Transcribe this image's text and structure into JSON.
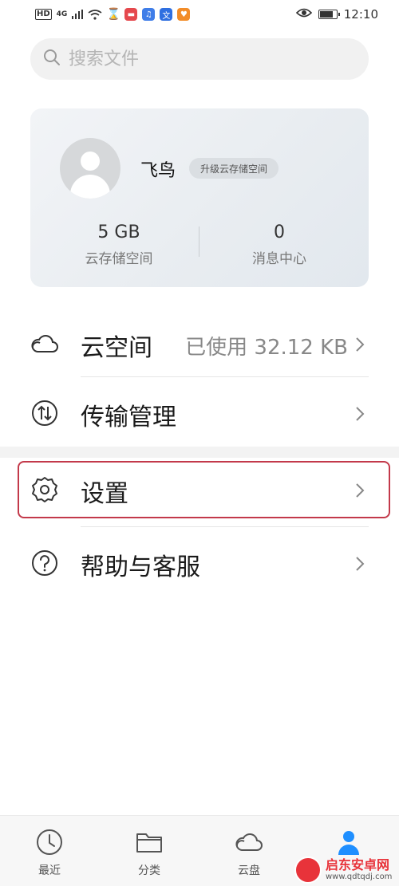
{
  "status_bar": {
    "hd": "HD",
    "network": "4G",
    "app_icons": [
      {
        "name": "hourglass",
        "glyph": "⌛",
        "color": "#333333"
      },
      {
        "name": "red-app",
        "glyph": "▬",
        "color": "#e5484d"
      },
      {
        "name": "music-app",
        "glyph": "♫",
        "color": "#3f7de8"
      },
      {
        "name": "translate-app",
        "glyph": "文",
        "color": "#2f6fe0"
      },
      {
        "name": "orange-app",
        "glyph": "♥",
        "color": "#f28c28"
      }
    ],
    "time": "12:10",
    "battery_level": 0.85
  },
  "search": {
    "placeholder": "搜索文件"
  },
  "profile": {
    "username": "飞鸟",
    "upgrade_label": "升级云存储空间",
    "stats": [
      {
        "value": "5 GB",
        "label": "云存储空间"
      },
      {
        "value": "0",
        "label": "消息中心"
      }
    ]
  },
  "menu": {
    "cloud_space": {
      "label": "云空间",
      "trail": "已使用 32.12 KB"
    },
    "transfer": {
      "label": "传输管理"
    },
    "settings": {
      "label": "设置"
    },
    "help": {
      "label": "帮助与客服"
    }
  },
  "tabs": [
    {
      "label": "最近",
      "icon": "clock-icon"
    },
    {
      "label": "分类",
      "icon": "folder-icon"
    },
    {
      "label": "云盘",
      "icon": "cloud-icon"
    },
    {
      "label": "",
      "icon": "user-icon",
      "active": true
    }
  ],
  "colors": {
    "accent": "#1f8fff",
    "highlight_border": "#c3394a",
    "watermark": "#e8333a"
  },
  "watermark": {
    "name": "启东安卓网",
    "url": "www.qdtqdj.com"
  }
}
